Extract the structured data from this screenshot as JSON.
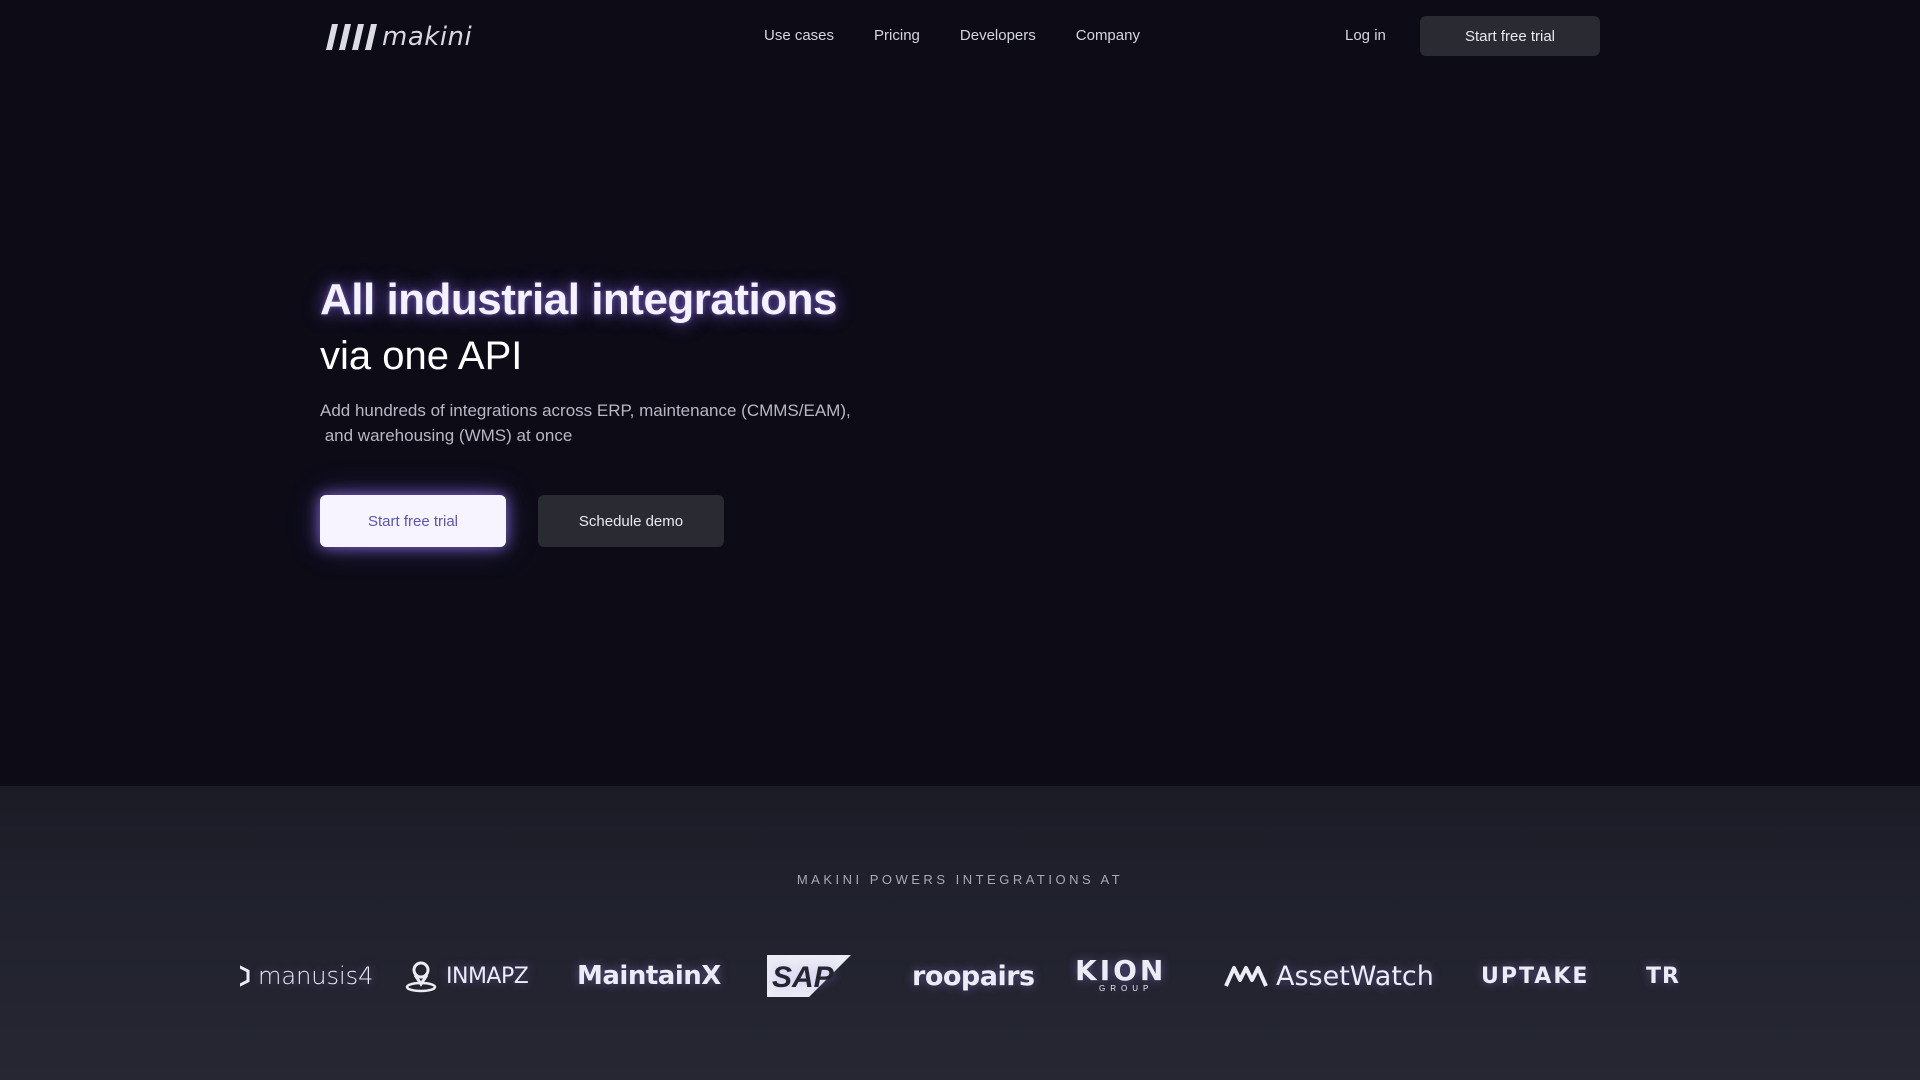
{
  "header": {
    "logo_text": "makini",
    "nav": [
      {
        "label": "Use cases"
      },
      {
        "label": "Pricing"
      },
      {
        "label": "Developers"
      },
      {
        "label": "Company"
      }
    ],
    "login_label": "Log in",
    "cta_label": "Start free trial"
  },
  "hero": {
    "title": "All industrial integrations",
    "subtitle": "via one API",
    "description_line1": "Add hundreds of integrations across ERP, maintenance (CMMS/EAM),",
    "description_line2": " and warehousing (WMS) at once",
    "primary_cta": "Start free trial",
    "secondary_cta": "Schedule demo"
  },
  "logos": {
    "heading": "MAKINI POWERS INTEGRATIONS AT",
    "brands": [
      {
        "name": "manusis4",
        "icon": "manusis-hexagon-icon"
      },
      {
        "name": "INMAPZ",
        "icon": "map-pin-icon"
      },
      {
        "name": "MaintainX"
      },
      {
        "name": "SAP"
      },
      {
        "name": "roopairs"
      },
      {
        "name": "KION",
        "sub": "GROUP"
      },
      {
        "name": "AssetWatch",
        "icon": "assetwatch-mark-icon"
      },
      {
        "name": "UPTAKE"
      },
      {
        "name": "TR"
      }
    ]
  },
  "colors": {
    "page_background": "#0c0b16",
    "glow_accent": "#9670ff",
    "primary_button_bg": "#f7f4ff",
    "primary_button_text": "#5a55b8",
    "secondary_button_bg": "#2a2a33",
    "logos_section_bg": "#20212c"
  }
}
